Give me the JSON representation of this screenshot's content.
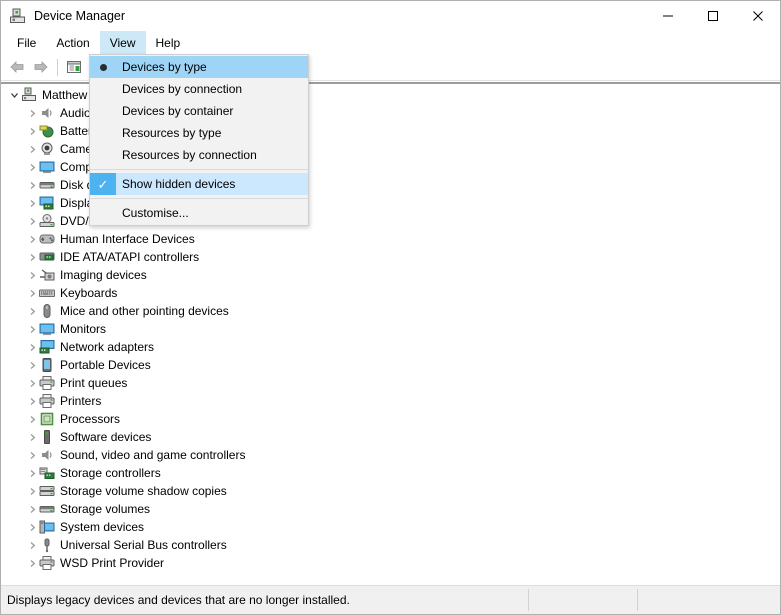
{
  "window": {
    "title": "Device Manager",
    "icon": "device-manager-icon",
    "controls": {
      "minimize": "minimize-icon",
      "maximize": "maximize-icon",
      "close": "close-icon"
    }
  },
  "menubar": {
    "items": [
      {
        "label": "File",
        "active": false
      },
      {
        "label": "Action",
        "active": false
      },
      {
        "label": "View",
        "active": true
      },
      {
        "label": "Help",
        "active": false
      }
    ]
  },
  "toolbar": {
    "buttons": [
      {
        "name": "back-button",
        "icon": "back-arrow-icon"
      },
      {
        "name": "forward-button",
        "icon": "forward-arrow-icon"
      },
      {
        "name": "properties-button",
        "icon": "properties-icon"
      }
    ]
  },
  "view_menu": {
    "items": [
      {
        "label": "Devices by type",
        "state": "radio-selected",
        "separator_after": false
      },
      {
        "label": "Devices by connection",
        "state": "none",
        "separator_after": false
      },
      {
        "label": "Devices by container",
        "state": "none",
        "separator_after": false
      },
      {
        "label": "Resources by type",
        "state": "none",
        "separator_after": false
      },
      {
        "label": "Resources by connection",
        "state": "none",
        "separator_after": true
      },
      {
        "label": "Show hidden devices",
        "state": "checked-highlighted",
        "separator_after": true
      },
      {
        "label": "Customise...",
        "state": "none",
        "separator_after": false
      }
    ]
  },
  "tree": {
    "root": {
      "label": "Matthew",
      "icon": "computer-icon",
      "expanded": true
    },
    "items": [
      {
        "label": "Audio inputs and outputs",
        "icon": "speaker-icon"
      },
      {
        "label": "Batteries",
        "icon": "battery-icon"
      },
      {
        "label": "Cameras",
        "icon": "camera-icon"
      },
      {
        "label": "Computer",
        "icon": "monitor-icon"
      },
      {
        "label": "Disk drives",
        "icon": "disk-icon"
      },
      {
        "label": "Display adapters",
        "icon": "display-adapter-icon"
      },
      {
        "label": "DVD/CD-ROM drives",
        "icon": "dvd-icon"
      },
      {
        "label": "Human Interface Devices",
        "icon": "hid-icon"
      },
      {
        "label": "IDE ATA/ATAPI controllers",
        "icon": "ide-controller-icon"
      },
      {
        "label": "Imaging devices",
        "icon": "imaging-icon"
      },
      {
        "label": "Keyboards",
        "icon": "keyboard-icon"
      },
      {
        "label": "Mice and other pointing devices",
        "icon": "mouse-icon"
      },
      {
        "label": "Monitors",
        "icon": "monitor-icon"
      },
      {
        "label": "Network adapters",
        "icon": "network-adapter-icon"
      },
      {
        "label": "Portable Devices",
        "icon": "portable-device-icon"
      },
      {
        "label": "Print queues",
        "icon": "printer-icon"
      },
      {
        "label": "Printers",
        "icon": "printer-icon"
      },
      {
        "label": "Processors",
        "icon": "processor-icon"
      },
      {
        "label": "Software devices",
        "icon": "software-device-icon"
      },
      {
        "label": "Sound, video and game controllers",
        "icon": "speaker-icon"
      },
      {
        "label": "Storage controllers",
        "icon": "storage-controller-icon"
      },
      {
        "label": "Storage volume shadow copies",
        "icon": "storage-volume-icon"
      },
      {
        "label": "Storage volumes",
        "icon": "disk-icon"
      },
      {
        "label": "System devices",
        "icon": "system-device-icon"
      },
      {
        "label": "Universal Serial Bus controllers",
        "icon": "usb-icon"
      },
      {
        "label": "WSD Print Provider",
        "icon": "printer-icon"
      }
    ]
  },
  "statusbar": {
    "message": "Displays legacy devices and devices that are no longer installed."
  },
  "colors": {
    "menu_active": "#cde8f7",
    "menu_highlight": "#cce8ff",
    "check_gutter": "#4cb2f0",
    "radio_gutter": "#9ed5f7",
    "statusbar_bg": "#f0f0f0",
    "dropdown_bg": "#f2f2f2"
  }
}
